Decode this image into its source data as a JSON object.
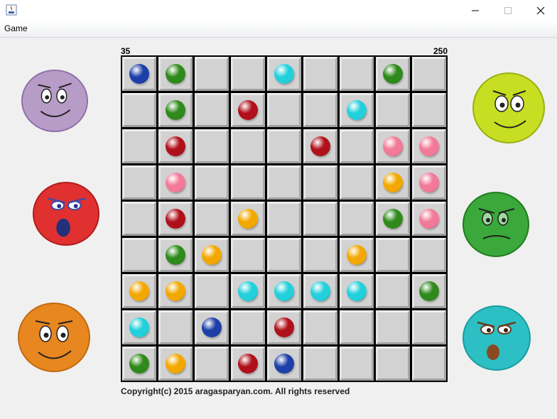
{
  "window": {
    "app_icon": "java-icon",
    "minimize_icon": "minimize-icon",
    "maximize_icon": "maximize-icon",
    "close_icon": "close-icon"
  },
  "menu": {
    "game_label": "Game"
  },
  "score": {
    "left": "35",
    "right": "250"
  },
  "board": {
    "rows": 9,
    "cols": 9,
    "cells": [
      [
        "blue",
        "green",
        "",
        "",
        "cyan",
        "",
        "",
        "green",
        ""
      ],
      [
        "",
        "green",
        "",
        "red",
        "",
        "",
        "cyan",
        "",
        ""
      ],
      [
        "",
        "red",
        "",
        "",
        "",
        "red",
        "",
        "pink",
        "pink"
      ],
      [
        "",
        "pink",
        "",
        "",
        "",
        "",
        "",
        "orange",
        "pink"
      ],
      [
        "",
        "red",
        "",
        "orange",
        "",
        "",
        "",
        "green",
        "pink"
      ],
      [
        "",
        "green",
        "orange",
        "",
        "",
        "",
        "orange",
        "",
        ""
      ],
      [
        "orange",
        "orange",
        "",
        "cyan",
        "cyan",
        "cyan",
        "cyan",
        "",
        "green"
      ],
      [
        "cyan",
        "",
        "blue",
        "",
        "red",
        "",
        "",
        "",
        ""
      ],
      [
        "green",
        "orange",
        "",
        "red",
        "blue",
        "",
        "",
        "",
        ""
      ]
    ]
  },
  "colors": {
    "blue": "#1d3fa8",
    "green": "#2f8a1c",
    "cyan": "#22d0dc",
    "red": "#b0101a",
    "pink": "#f27a98",
    "orange": "#f2a800"
  },
  "faces": [
    {
      "name": "purple-smiley-face",
      "color": "#b89cc8"
    },
    {
      "name": "red-surprised-face",
      "color": "#e03030"
    },
    {
      "name": "orange-smiley-face",
      "color": "#e88620"
    },
    {
      "name": "yellow-smiley-face",
      "color": "#c8de22"
    },
    {
      "name": "green-grumpy-face",
      "color": "#3aa83a"
    },
    {
      "name": "cyan-surprised-face",
      "color": "#2cc0c4"
    }
  ],
  "footer": {
    "copyright": "Copyright(c) 2015 aragasparyan.com. All rights reserved"
  }
}
